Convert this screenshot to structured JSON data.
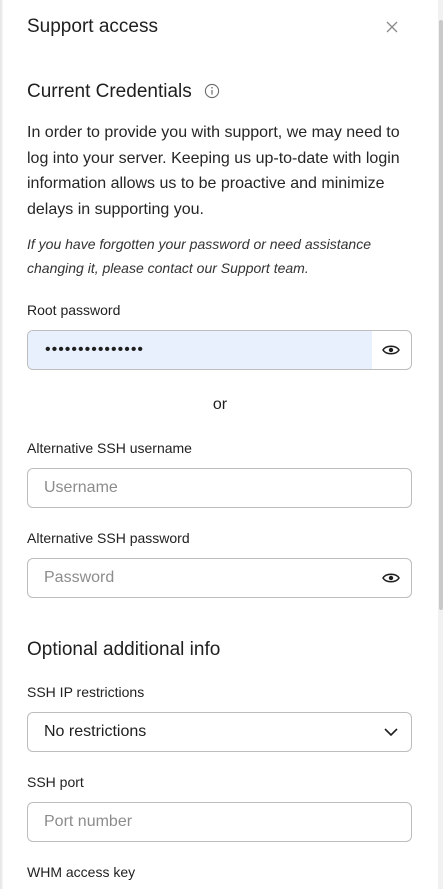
{
  "header": {
    "title": "Support access"
  },
  "credentials": {
    "section_title": "Current Credentials",
    "intro": "In order to provide you with support, we may need to log into your server. Keeping us up-to-date with login information allows us to be proactive and minimize delays in supporting you.",
    "note": "If you have forgotten your password or need assistance changing it, please contact our Support team.",
    "root_password_label": "Root password",
    "root_password_value": "•••••••••••••••",
    "or_text": "or",
    "alt_ssh_username_label": "Alternative SSH username",
    "alt_ssh_username_placeholder": "Username",
    "alt_ssh_password_label": "Alternative SSH password",
    "alt_ssh_password_placeholder": "Password"
  },
  "optional": {
    "section_title": "Optional additional info",
    "ssh_ip_label": "SSH IP restrictions",
    "ssh_ip_value": "No restrictions",
    "ssh_port_label": "SSH port",
    "ssh_port_placeholder": "Port number",
    "whm_label": "WHM access key"
  },
  "icons": {
    "close": "close-icon",
    "info": "info-icon",
    "eye": "eye-icon",
    "chevron": "chevron-down-icon"
  },
  "colors": {
    "autofill_bg": "#e8f0fe",
    "border": "#bdbdbd",
    "placeholder": "#8c8c8c"
  }
}
